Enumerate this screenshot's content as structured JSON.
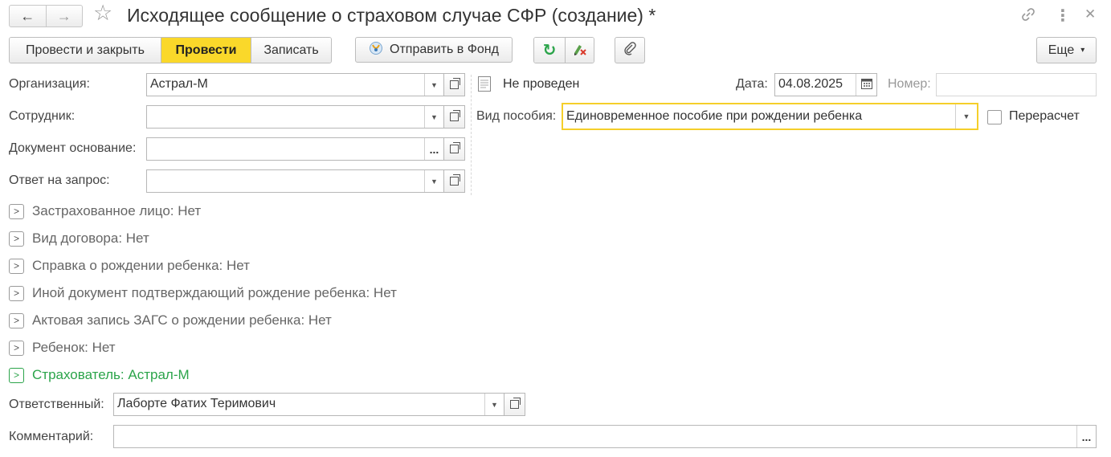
{
  "window": {
    "title": "Исходящее сообщение о страховом случае СФР (создание) *",
    "back_icon": "←",
    "forward_icon": "→",
    "star_icon": "☆",
    "link_icon": "🔗",
    "menu_icon": "⋮",
    "close_icon": "✕"
  },
  "toolbar": {
    "post_close": "Провести и закрыть",
    "post": "Провести",
    "save": "Записать",
    "send_fund": "Отправить в Фонд",
    "more": "Еще",
    "refresh_icon": "↻",
    "more_arrow": "▾",
    "accent_color": "#fad82a"
  },
  "form": {
    "organization": {
      "label": "Организация:",
      "value": "Астрал-М"
    },
    "employee": {
      "label": "Сотрудник:",
      "value": ""
    },
    "base_document": {
      "label": "Документ основание:",
      "value": ""
    },
    "request_answer": {
      "label": "Ответ на запрос:",
      "value": ""
    },
    "status": "Не проведен",
    "date": {
      "label": "Дата:",
      "value": "04.08.2025"
    },
    "number": {
      "label": "Номер:",
      "value": ""
    },
    "benefit_type": {
      "label": "Вид пособия:",
      "value": "Единовременное пособие при рождении ребенка"
    },
    "recalc": {
      "label": "Перерасчет",
      "checked": false
    },
    "responsible": {
      "label": "Ответственный:",
      "value": "Лаборте Фатих Теримович"
    },
    "comment": {
      "label": "Комментарий:",
      "value": ""
    }
  },
  "groups": [
    {
      "text": "Застрахованное лицо: Нет"
    },
    {
      "text": "Вид договора: Нет"
    },
    {
      "text": "Справка о рождении ребенка: Нет"
    },
    {
      "text": "Иной документ подтверждающий рождение ребенка: Нет"
    },
    {
      "text": "Актовая запись ЗАГС о рождении ребенка: Нет"
    },
    {
      "text": "Ребенок: Нет"
    },
    {
      "text": "Страхователь: Астрал-М"
    }
  ]
}
